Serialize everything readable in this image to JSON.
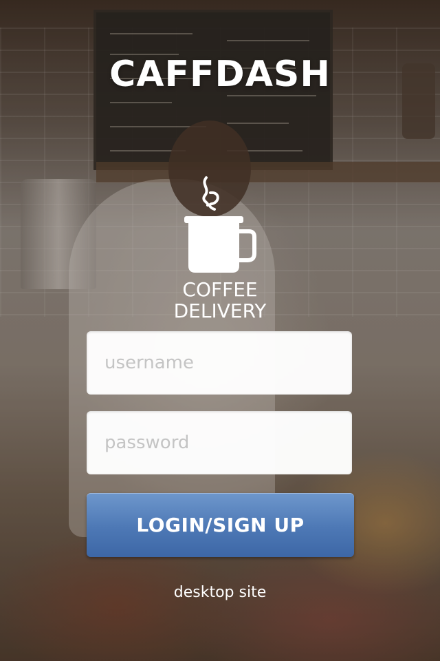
{
  "app": {
    "brand_title": "CAFFDASH",
    "tagline_line1": "COFFEE",
    "tagline_line2": "DELIVERY",
    "logo_icon": "coffee-mug-icon"
  },
  "login_form": {
    "username_placeholder": "username",
    "username_value": "",
    "password_placeholder": "password",
    "password_value": "",
    "submit_label": "LOGIN/SIGN UP"
  },
  "footer": {
    "desktop_link_label": "desktop site"
  },
  "colors": {
    "button_blue": "#4d78b5",
    "text_white": "#ffffff",
    "field_white": "#ffffff",
    "placeholder_gray": "#c4c4c4"
  }
}
